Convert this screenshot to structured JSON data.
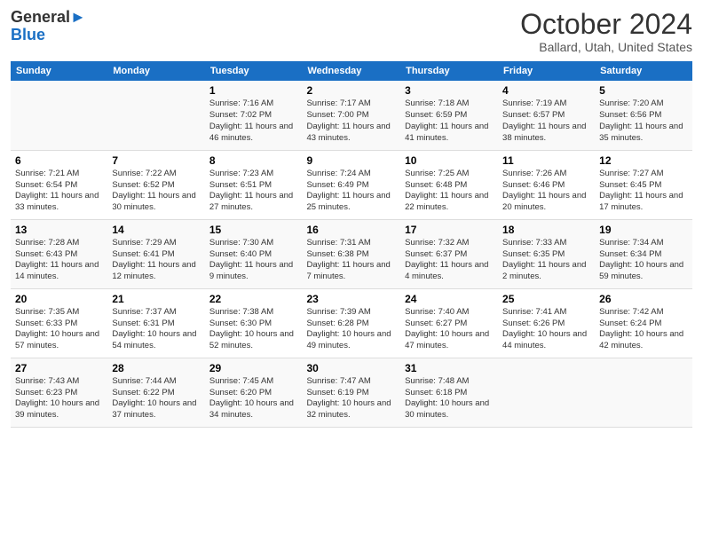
{
  "header": {
    "logo_line1": "General",
    "logo_line2": "Blue",
    "month": "October 2024",
    "location": "Ballard, Utah, United States"
  },
  "days_of_week": [
    "Sunday",
    "Monday",
    "Tuesday",
    "Wednesday",
    "Thursday",
    "Friday",
    "Saturday"
  ],
  "weeks": [
    [
      {
        "day": "",
        "info": ""
      },
      {
        "day": "",
        "info": ""
      },
      {
        "day": "1",
        "info": "Sunrise: 7:16 AM\nSunset: 7:02 PM\nDaylight: 11 hours and 46 minutes."
      },
      {
        "day": "2",
        "info": "Sunrise: 7:17 AM\nSunset: 7:00 PM\nDaylight: 11 hours and 43 minutes."
      },
      {
        "day": "3",
        "info": "Sunrise: 7:18 AM\nSunset: 6:59 PM\nDaylight: 11 hours and 41 minutes."
      },
      {
        "day": "4",
        "info": "Sunrise: 7:19 AM\nSunset: 6:57 PM\nDaylight: 11 hours and 38 minutes."
      },
      {
        "day": "5",
        "info": "Sunrise: 7:20 AM\nSunset: 6:56 PM\nDaylight: 11 hours and 35 minutes."
      }
    ],
    [
      {
        "day": "6",
        "info": "Sunrise: 7:21 AM\nSunset: 6:54 PM\nDaylight: 11 hours and 33 minutes."
      },
      {
        "day": "7",
        "info": "Sunrise: 7:22 AM\nSunset: 6:52 PM\nDaylight: 11 hours and 30 minutes."
      },
      {
        "day": "8",
        "info": "Sunrise: 7:23 AM\nSunset: 6:51 PM\nDaylight: 11 hours and 27 minutes."
      },
      {
        "day": "9",
        "info": "Sunrise: 7:24 AM\nSunset: 6:49 PM\nDaylight: 11 hours and 25 minutes."
      },
      {
        "day": "10",
        "info": "Sunrise: 7:25 AM\nSunset: 6:48 PM\nDaylight: 11 hours and 22 minutes."
      },
      {
        "day": "11",
        "info": "Sunrise: 7:26 AM\nSunset: 6:46 PM\nDaylight: 11 hours and 20 minutes."
      },
      {
        "day": "12",
        "info": "Sunrise: 7:27 AM\nSunset: 6:45 PM\nDaylight: 11 hours and 17 minutes."
      }
    ],
    [
      {
        "day": "13",
        "info": "Sunrise: 7:28 AM\nSunset: 6:43 PM\nDaylight: 11 hours and 14 minutes."
      },
      {
        "day": "14",
        "info": "Sunrise: 7:29 AM\nSunset: 6:41 PM\nDaylight: 11 hours and 12 minutes."
      },
      {
        "day": "15",
        "info": "Sunrise: 7:30 AM\nSunset: 6:40 PM\nDaylight: 11 hours and 9 minutes."
      },
      {
        "day": "16",
        "info": "Sunrise: 7:31 AM\nSunset: 6:38 PM\nDaylight: 11 hours and 7 minutes."
      },
      {
        "day": "17",
        "info": "Sunrise: 7:32 AM\nSunset: 6:37 PM\nDaylight: 11 hours and 4 minutes."
      },
      {
        "day": "18",
        "info": "Sunrise: 7:33 AM\nSunset: 6:35 PM\nDaylight: 11 hours and 2 minutes."
      },
      {
        "day": "19",
        "info": "Sunrise: 7:34 AM\nSunset: 6:34 PM\nDaylight: 10 hours and 59 minutes."
      }
    ],
    [
      {
        "day": "20",
        "info": "Sunrise: 7:35 AM\nSunset: 6:33 PM\nDaylight: 10 hours and 57 minutes."
      },
      {
        "day": "21",
        "info": "Sunrise: 7:37 AM\nSunset: 6:31 PM\nDaylight: 10 hours and 54 minutes."
      },
      {
        "day": "22",
        "info": "Sunrise: 7:38 AM\nSunset: 6:30 PM\nDaylight: 10 hours and 52 minutes."
      },
      {
        "day": "23",
        "info": "Sunrise: 7:39 AM\nSunset: 6:28 PM\nDaylight: 10 hours and 49 minutes."
      },
      {
        "day": "24",
        "info": "Sunrise: 7:40 AM\nSunset: 6:27 PM\nDaylight: 10 hours and 47 minutes."
      },
      {
        "day": "25",
        "info": "Sunrise: 7:41 AM\nSunset: 6:26 PM\nDaylight: 10 hours and 44 minutes."
      },
      {
        "day": "26",
        "info": "Sunrise: 7:42 AM\nSunset: 6:24 PM\nDaylight: 10 hours and 42 minutes."
      }
    ],
    [
      {
        "day": "27",
        "info": "Sunrise: 7:43 AM\nSunset: 6:23 PM\nDaylight: 10 hours and 39 minutes."
      },
      {
        "day": "28",
        "info": "Sunrise: 7:44 AM\nSunset: 6:22 PM\nDaylight: 10 hours and 37 minutes."
      },
      {
        "day": "29",
        "info": "Sunrise: 7:45 AM\nSunset: 6:20 PM\nDaylight: 10 hours and 34 minutes."
      },
      {
        "day": "30",
        "info": "Sunrise: 7:47 AM\nSunset: 6:19 PM\nDaylight: 10 hours and 32 minutes."
      },
      {
        "day": "31",
        "info": "Sunrise: 7:48 AM\nSunset: 6:18 PM\nDaylight: 10 hours and 30 minutes."
      },
      {
        "day": "",
        "info": ""
      },
      {
        "day": "",
        "info": ""
      }
    ]
  ]
}
